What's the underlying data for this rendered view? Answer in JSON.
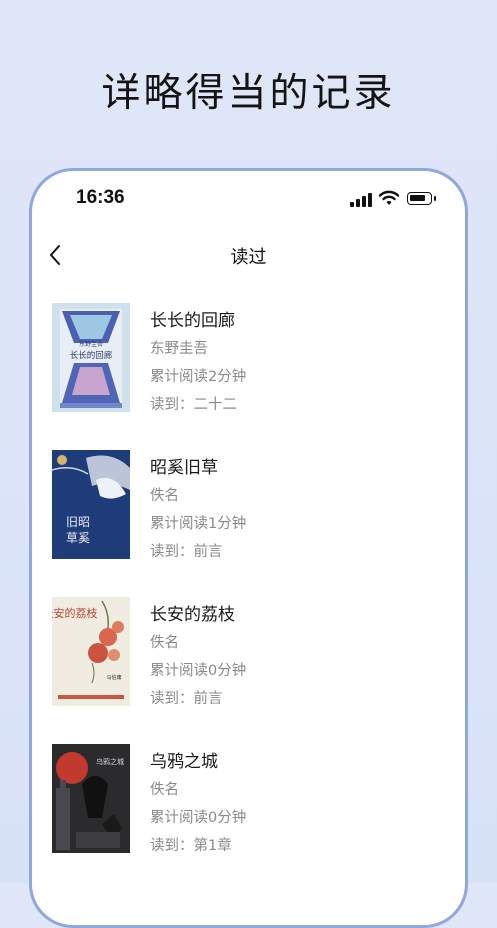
{
  "headline": "详略得当的记录",
  "status_bar": {
    "time": "16:36"
  },
  "nav": {
    "title": "读过",
    "back_icon": "chevron-left-icon"
  },
  "colors": {
    "accent_border": "#8ea7dc",
    "background": "#dfe6f8"
  },
  "books": [
    {
      "title": "长长的回廊",
      "author": "东野圭吾",
      "read_time": "累计阅读2分钟",
      "progress": "读到：二十二",
      "cover_text": [
        "东野圭吾",
        "长长的回廊"
      ]
    },
    {
      "title": "昭奚旧草",
      "author": "佚名",
      "read_time": "累计阅读1分钟",
      "progress": "读到：前言",
      "cover_text": [
        "旧昭",
        "草奚"
      ]
    },
    {
      "title": "长安的荔枝",
      "author": "佚名",
      "read_time": "累计阅读0分钟",
      "progress": "读到：前言",
      "cover_text": [
        "长安的荔枝",
        "马伯庸"
      ]
    },
    {
      "title": "乌鸦之城",
      "author": "佚名",
      "read_time": "累计阅读0分钟",
      "progress": "读到：第1章",
      "cover_text": [
        "乌鸦之城"
      ]
    }
  ]
}
